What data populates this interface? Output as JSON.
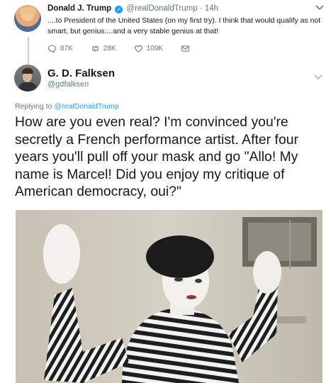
{
  "parent_tweet": {
    "name": "Donald J. Trump",
    "handle": "@realDonaldTrump",
    "separator": "·",
    "time": "14h",
    "text": "....to President of the United States (on my first try). I think that would qualify as not smart, but genius....and a very stable genius at that!",
    "replies": "87K",
    "retweets": "28K",
    "likes": "109K"
  },
  "reply_tweet": {
    "name": "G. D. Falksen",
    "handle": "@gdfalksen",
    "replying_prefix": "Replying to",
    "replying_to": "@realDonaldTrump",
    "text": "How are you even real? I'm convinced you're secretly a French performance artist. After four years you'll pull off your mask and go \"Allo! My name is Marcel! Did you enjoy my critique of American democracy, oui?\""
  },
  "icons": {
    "verified": "verified-badge-icon",
    "reply": "reply-icon",
    "retweet": "retweet-icon",
    "like": "heart-icon",
    "dm": "envelope-icon",
    "more": "chevron-down-icon"
  },
  "colors": {
    "accent": "#1da1f2",
    "secondary_text": "#657786",
    "thread_line": "#c4cfd6"
  }
}
